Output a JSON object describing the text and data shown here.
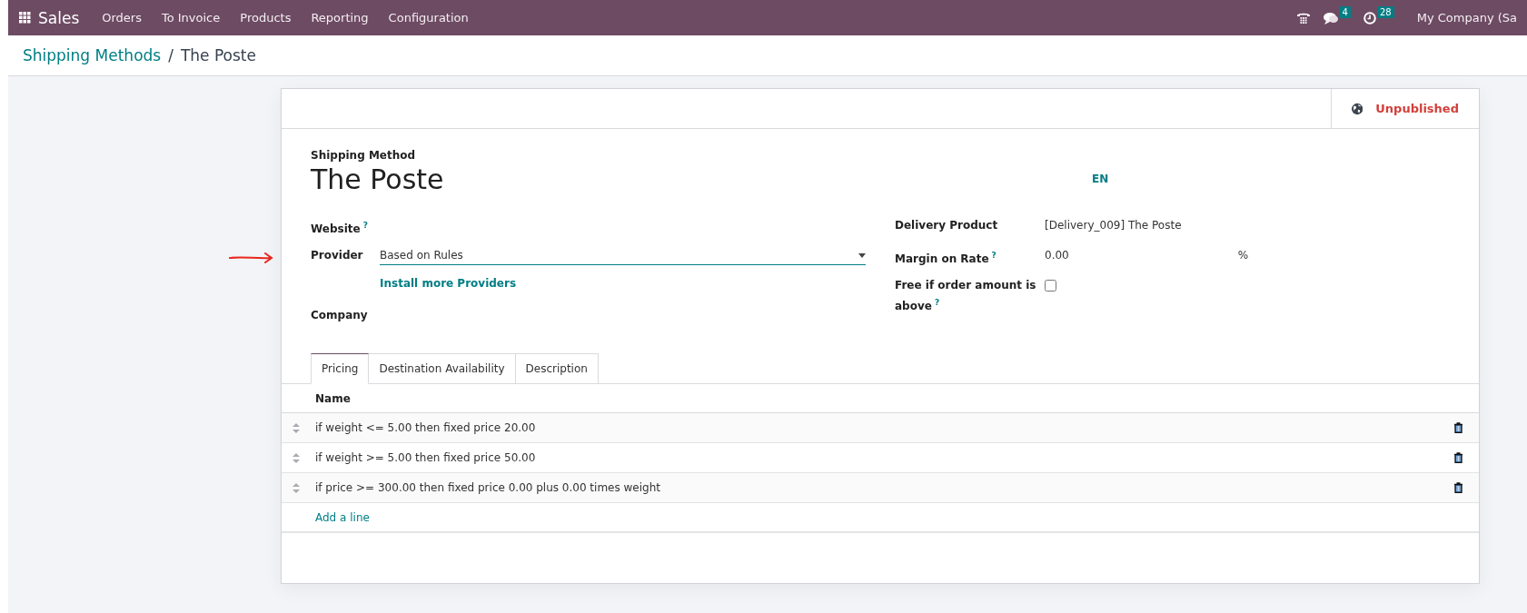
{
  "navbar": {
    "app": "Sales",
    "menu": [
      "Orders",
      "To Invoice",
      "Products",
      "Reporting",
      "Configuration"
    ],
    "messages_count": "4",
    "activities_count": "28",
    "company": "My Company (Sa"
  },
  "breadcrumb": {
    "parent": "Shipping Methods",
    "separator": "/",
    "current": "The Poste"
  },
  "status": {
    "publish_label": "Unpublished",
    "published": false
  },
  "form": {
    "title_label": "Shipping Method",
    "title": "The Poste",
    "language": "EN",
    "left_fields": [
      {
        "label": "Website",
        "help": "?"
      },
      {
        "label": "Provider",
        "value": "Based on Rules",
        "kind": "select",
        "link": "Install more Providers"
      },
      {
        "label": "Company"
      }
    ],
    "right_fields": [
      {
        "label": "Delivery Product",
        "kind": "text",
        "value": "[Delivery_009] The Poste"
      },
      {
        "label": "Margin on Rate",
        "help": "?",
        "kind": "percent",
        "value": "0.00",
        "unit": "%"
      },
      {
        "label": "Free if order amount is above",
        "help": "?",
        "kind": "checkbox",
        "checked": false
      }
    ]
  },
  "tabs": [
    {
      "label": "Pricing",
      "selected": true
    },
    {
      "label": "Destination Availability",
      "selected": false
    },
    {
      "label": "Description",
      "selected": false
    }
  ],
  "table": {
    "columns": [
      "Name"
    ],
    "rows": [
      "if weight <= 5.00 then fixed price 20.00",
      "if weight >= 5.00 then fixed price 50.00",
      "if price >= 300.00 then fixed price 0.00 plus 0.00 times weight"
    ],
    "add_line": "Add a line"
  }
}
